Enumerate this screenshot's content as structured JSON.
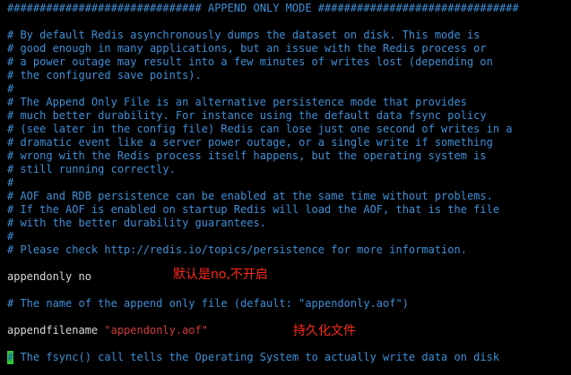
{
  "editor": {
    "lines": [
      "############################## APPEND ONLY MODE ###############################",
      "",
      "# By default Redis asynchronously dumps the dataset on disk. This mode is",
      "# good enough in many applications, but an issue with the Redis process or",
      "# a power outage may result into a few minutes of writes lost (depending on",
      "# the configured save points).",
      "#",
      "# The Append Only File is an alternative persistence mode that provides",
      "# much better durability. For instance using the default data fsync policy",
      "# (see later in the config file) Redis can lose just one second of writes in a",
      "# dramatic event like a server power outage, or a single write if something",
      "# wrong with the Redis process itself happens, but the operating system is",
      "# still running correctly.",
      "#",
      "# AOF and RDB persistence can be enabled at the same time without problems.",
      "# If the AOF is enabled on startup Redis will load the AOF, that is the file",
      "# with the better durability guarantees.",
      "#",
      "# Please check http://redis.io/topics/persistence for more information."
    ],
    "appendonly": {
      "key": "appendonly",
      "value": "no"
    },
    "aof_name_comment": "# The name of the append only file (default: \"appendonly.aof\")",
    "appendfilename": {
      "key": "appendfilename",
      "value": "\"appendonly.aof\""
    },
    "cursor_char": "#",
    "fsync_comment_rest": " The fsync() call tells the Operating System to actually write data on disk"
  },
  "annotations": {
    "appendonly_note": "默认是no,不开启",
    "appendfilename_note": "持久化文件"
  },
  "colors": {
    "background": "#000000",
    "comment": "#3f8fd6",
    "text": "#d8d8d8",
    "string": "#d23c3c",
    "cursor": "#35c735",
    "annotation": "#ff2a1a"
  }
}
